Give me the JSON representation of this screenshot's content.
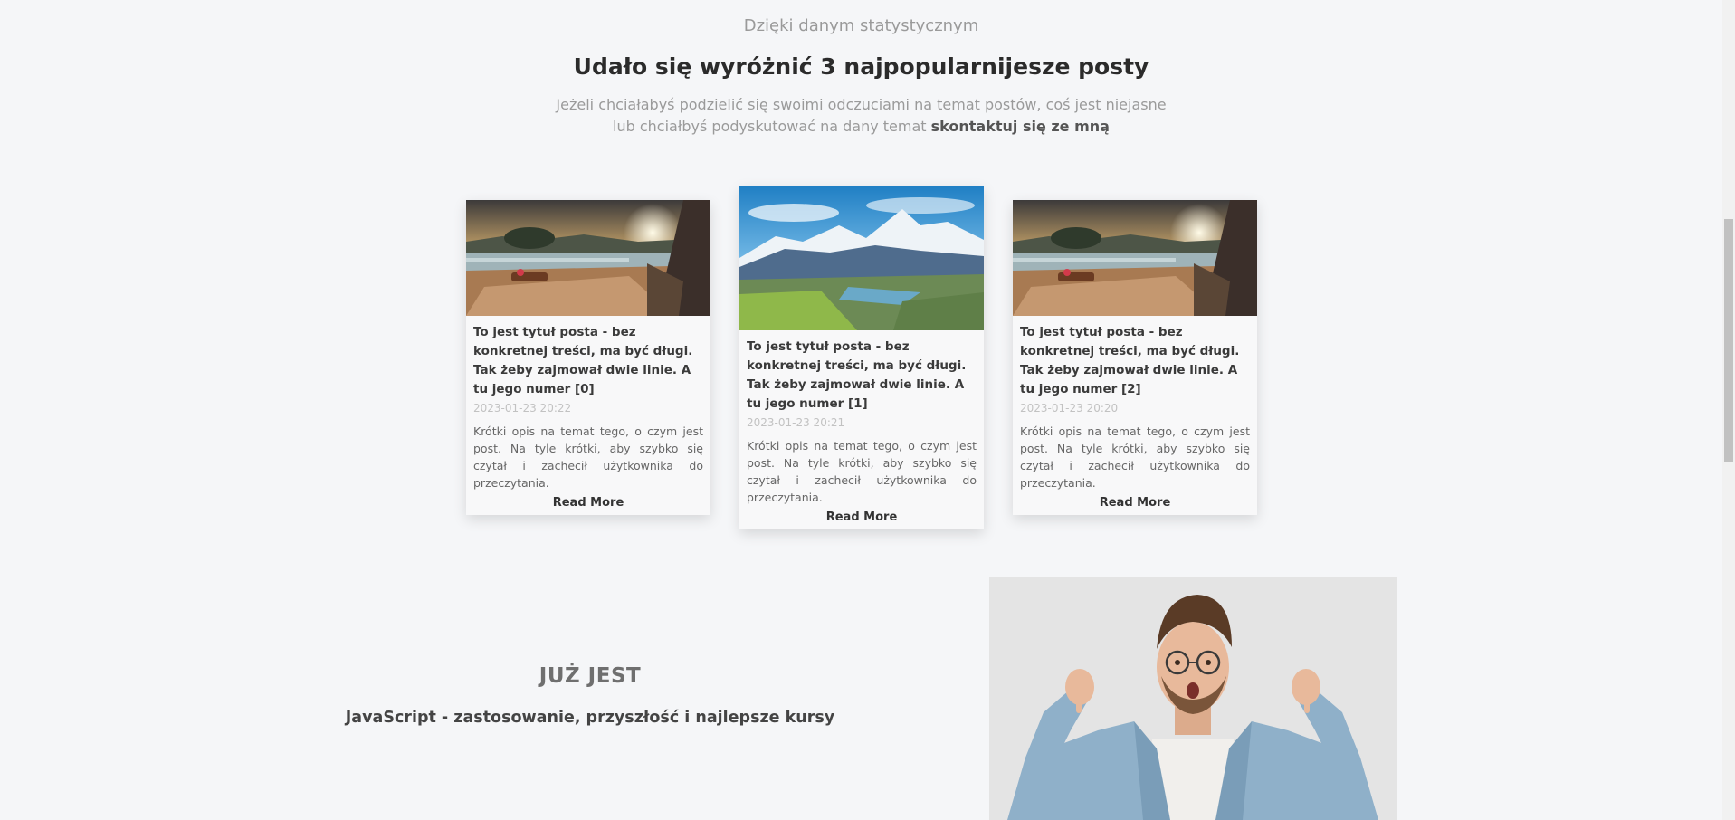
{
  "intro": {
    "kicker": "Dzięki danym statystycznym",
    "heading": "Udało się wyróżnić 3 najpopularnijesze posty",
    "lead_line1": "Jeżeli chciałabyś podzielić się swoimi odczuciami na temat postów, coś jest niejasne",
    "lead_line2": "lub chciałbyś podyskutować na dany temat",
    "lead_link": "skontaktuj się ze mną"
  },
  "posts": [
    {
      "title": "To jest tytuł posta - bez konkretnej treści, ma być długi. Tak żeby zajmował dwie linie. A tu jego numer [0]",
      "date": "2023-01-23 20:22",
      "description": "Krótki opis na temat tego, o czym jest post. Na tyle krótki, aby szybko się czytał i zachecił użytkownika do przeczytania.",
      "read_more": "Read More",
      "image": "resort-sunset-photo"
    },
    {
      "title": "To jest tytuł posta - bez konkretnej treści, ma być długi. Tak żeby zajmował dwie linie. A tu jego numer [1]",
      "date": "2023-01-23 20:21",
      "description": "Krótki opis na temat tego, o czym jest post. Na tyle krótki, aby szybko się czytał i zachecił użytkownika do przeczytania.",
      "read_more": "Read More",
      "image": "mountain-valley-photo"
    },
    {
      "title": "To jest tytuł posta - bez konkretnej treści, ma być długi. Tak żeby zajmował dwie linie. A tu jego numer [2]",
      "date": "2023-01-23 20:20",
      "description": "Krótki opis na temat tego, o czym jest post. Na tyle krótki, aby szybko się czytał i zachecił użytkownika do przeczytania.",
      "read_more": "Read More",
      "image": "resort-sunset-photo"
    }
  ],
  "promo": {
    "label": "JUŻ JEST",
    "title": "JavaScript - zastosowanie, przyszłość i najlepsze kursy",
    "image": "surprised-man-pointing-down-photo"
  },
  "colors": {
    "background": "#f5f6f8",
    "card": "#f8f8f9",
    "heading": "#2b2b2b",
    "muted": "#9a9a9a"
  }
}
